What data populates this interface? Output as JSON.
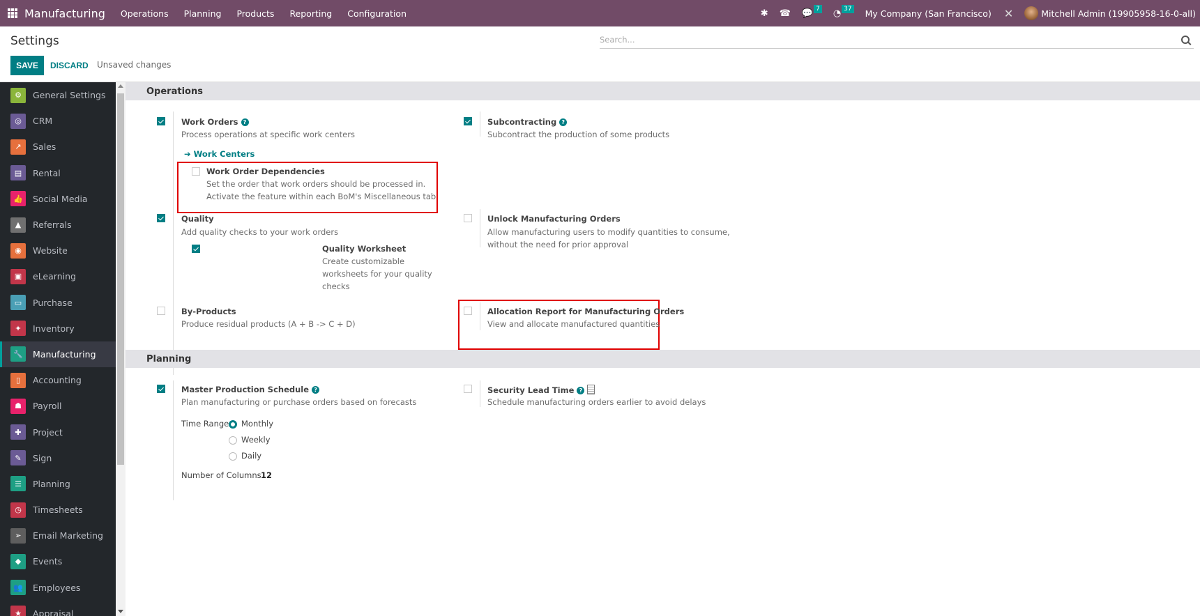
{
  "navbar": {
    "app_name": "Manufacturing",
    "menu": [
      "Operations",
      "Planning",
      "Products",
      "Reporting",
      "Configuration"
    ],
    "messages_count": "7",
    "activities_count": "37",
    "company": "My Company (San Francisco)",
    "user": "Mitchell Admin (19905958-16-0-all)",
    "brand_color": "#714b67"
  },
  "control_panel": {
    "title": "Settings",
    "save_label": "SAVE",
    "discard_label": "DISCARD",
    "status": "Unsaved changes",
    "search_placeholder": "Search..."
  },
  "sidebar": {
    "items": [
      {
        "label": "General Settings",
        "icon": "gear-icon",
        "color": "#8bb53b",
        "glyph": "⚙"
      },
      {
        "label": "CRM",
        "icon": "handshake-icon",
        "color": "#6b5b95",
        "glyph": "◎"
      },
      {
        "label": "Sales",
        "icon": "chart-icon",
        "color": "#e6703d",
        "glyph": "↗"
      },
      {
        "label": "Rental",
        "icon": "rental-icon",
        "color": "#6b5b95",
        "glyph": "▤"
      },
      {
        "label": "Social Media",
        "icon": "thumbs-up-icon",
        "color": "#e8226b",
        "glyph": "👍"
      },
      {
        "label": "Referrals",
        "icon": "referrals-icon",
        "color": "#707070",
        "glyph": "▲"
      },
      {
        "label": "Website",
        "icon": "globe-icon",
        "color": "#e6703d",
        "glyph": "◉"
      },
      {
        "label": "eLearning",
        "icon": "elearning-icon",
        "color": "#c2364a",
        "glyph": "▣"
      },
      {
        "label": "Purchase",
        "icon": "credit-card-icon",
        "color": "#4a9fb5",
        "glyph": "▭"
      },
      {
        "label": "Inventory",
        "icon": "box-icon",
        "color": "#c2364a",
        "glyph": "✦"
      },
      {
        "label": "Manufacturing",
        "icon": "wrench-icon",
        "color": "#1e9f84",
        "glyph": "🔧",
        "active": true
      },
      {
        "label": "Accounting",
        "icon": "accounting-icon",
        "color": "#e6703d",
        "glyph": "▯"
      },
      {
        "label": "Payroll",
        "icon": "payroll-icon",
        "color": "#e8226b",
        "glyph": "☗"
      },
      {
        "label": "Project",
        "icon": "puzzle-icon",
        "color": "#6b5b95",
        "glyph": "✚"
      },
      {
        "label": "Sign",
        "icon": "sign-icon",
        "color": "#6b5b95",
        "glyph": "✎"
      },
      {
        "label": "Planning",
        "icon": "planning-icon",
        "color": "#1e9f84",
        "glyph": "☰"
      },
      {
        "label": "Timesheets",
        "icon": "stopwatch-icon",
        "color": "#c2364a",
        "glyph": "◷"
      },
      {
        "label": "Email Marketing",
        "icon": "paper-plane-icon",
        "color": "#5e5e5e",
        "glyph": "➢"
      },
      {
        "label": "Events",
        "icon": "ticket-icon",
        "color": "#1e9f84",
        "glyph": "◆"
      },
      {
        "label": "Employees",
        "icon": "employees-icon",
        "color": "#1e9f84",
        "glyph": "👥"
      },
      {
        "label": "Appraisal",
        "icon": "star-icon",
        "color": "#c2364a",
        "glyph": "★"
      }
    ]
  },
  "sections": {
    "operations": {
      "title": "Operations",
      "work_orders": {
        "title": "Work Orders",
        "desc": "Process operations at specific work centers",
        "checked": true,
        "link": "Work Centers"
      },
      "work_order_dependencies": {
        "title": "Work Order Dependencies",
        "desc1": "Set the order that work orders should be processed in.",
        "desc2": "Activate the feature within each BoM's Miscellaneous tab",
        "checked": false
      },
      "subcontracting": {
        "title": "Subcontracting",
        "desc": "Subcontract the production of some products",
        "checked": true
      },
      "quality": {
        "title": "Quality",
        "desc": "Add quality checks to your work orders",
        "checked": true
      },
      "quality_worksheet": {
        "title": "Quality Worksheet",
        "desc1": "Create customizable",
        "desc2": "worksheets for your quality",
        "desc3": "checks",
        "checked": true
      },
      "unlock_mo": {
        "title": "Unlock Manufacturing Orders",
        "desc1": "Allow manufacturing users to modify quantities to consume,",
        "desc2": "without the need for prior approval",
        "checked": false
      },
      "by_products": {
        "title": "By-Products",
        "desc": "Produce residual products (A + B -> C + D)",
        "checked": false
      },
      "allocation_report": {
        "title": "Allocation Report for Manufacturing Orders",
        "desc": "View and allocate manufactured quantities",
        "checked": false
      }
    },
    "planning": {
      "title": "Planning",
      "mps": {
        "title": "Master Production Schedule",
        "desc": "Plan manufacturing or purchase orders based on forecasts",
        "checked": true,
        "time_range_label": "Time Range",
        "time_range_options": [
          "Monthly",
          "Weekly",
          "Daily"
        ],
        "time_range_selected": "Monthly",
        "columns_label": "Number of Columns",
        "columns_value": "12"
      },
      "security_lead_time": {
        "title": "Security Lead Time",
        "desc": "Schedule manufacturing orders earlier to avoid delays",
        "checked": false
      }
    }
  }
}
